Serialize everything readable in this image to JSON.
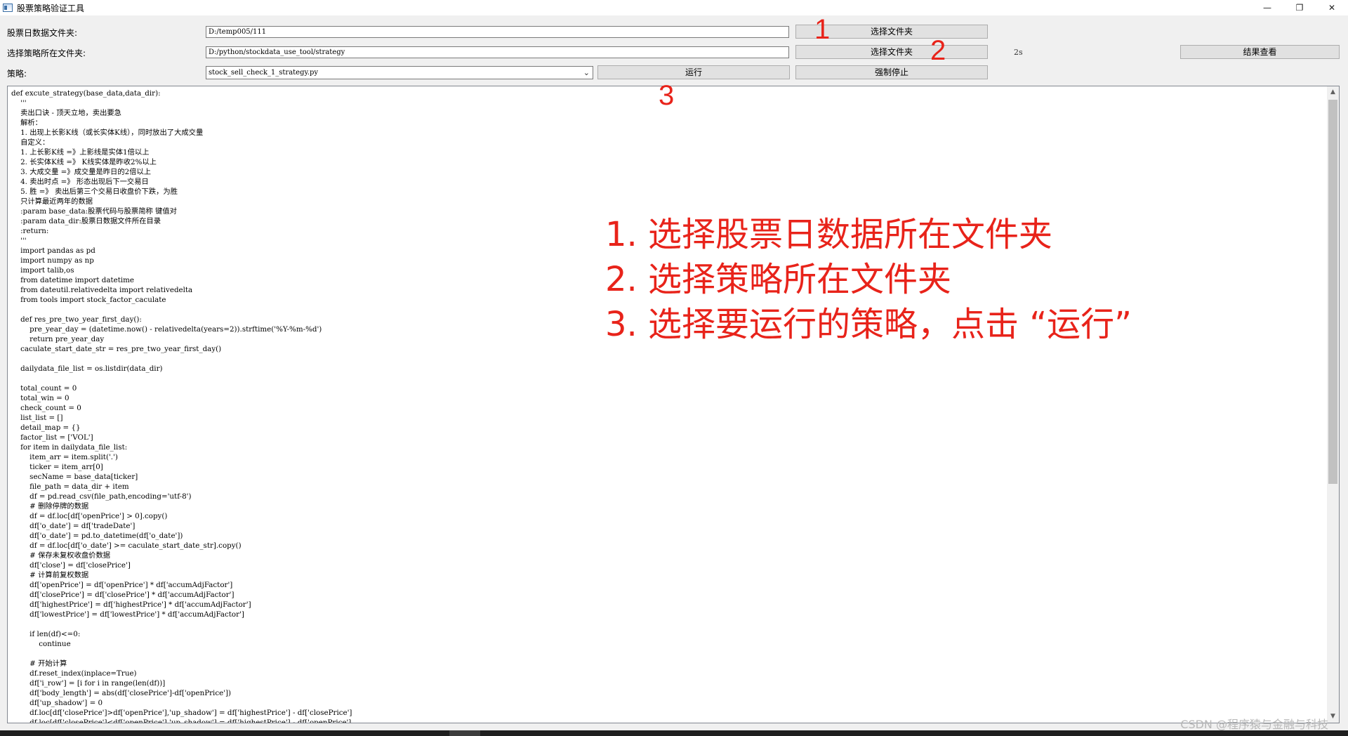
{
  "window": {
    "title": "股票策略验证工具",
    "controls": {
      "minimize": "—",
      "maximize": "❐",
      "close": "✕"
    }
  },
  "form": {
    "data_folder_label": "股票日数据文件夹:",
    "data_folder_value": "D:/temp005/111",
    "strategy_folder_label": "选择策略所在文件夹:",
    "strategy_folder_value": "D:/python/stockdata_use_tool/strategy",
    "strategy_label": "策略:",
    "strategy_selected": "stock_sell_check_1_strategy.py",
    "select_folder_button_1": "选择文件夹",
    "select_folder_button_2": "选择文件夹",
    "run_button": "运行",
    "force_stop_button": "强制停止",
    "view_results_button": "结果查看",
    "elapsed": "2s"
  },
  "code": [
    "def excute_strategy(base_data,data_dir):",
    "    '''",
    "    卖出口诀 - 顶天立地，卖出要急",
    "    解析：",
    "    1. 出现上长影K线（或长实体K线），同时放出了大成交量",
    "    自定义：",
    "    1. 上长影K线 =》上影线是实体1倍以上",
    "    2. 长实体K线 =》 K线实体是昨收2%以上",
    "    3. 大成交量 =》成交量是昨日的2倍以上",
    "    4. 卖出时点 =》 形态出现后下一交易日",
    "    5. 胜 =》 卖出后第三个交易日收盘价下跌，为胜",
    "    只计算最近两年的数据",
    "    :param base_data:股票代码与股票简称 键值对",
    "    :param data_dir:股票日数据文件所在目录",
    "    :return:",
    "    '''",
    "    import pandas as pd",
    "    import numpy as np",
    "    import talib,os",
    "    from datetime import datetime",
    "    from dateutil.relativedelta import relativedelta",
    "    from tools import stock_factor_caculate",
    "",
    "    def res_pre_two_year_first_day():",
    "        pre_year_day = (datetime.now() - relativedelta(years=2)).strftime('%Y-%m-%d')",
    "        return pre_year_day",
    "    caculate_start_date_str = res_pre_two_year_first_day()",
    "",
    "    dailydata_file_list = os.listdir(data_dir)",
    "",
    "    total_count = 0",
    "    total_win = 0",
    "    check_count = 0",
    "    list_list = []",
    "    detail_map = {}",
    "    factor_list = ['VOL']",
    "    for item in dailydata_file_list:",
    "        item_arr = item.split('.')",
    "        ticker = item_arr[0]",
    "        secName = base_data[ticker]",
    "        file_path = data_dir + item",
    "        df = pd.read_csv(file_path,encoding='utf-8')",
    "        # 删除停牌的数据",
    "        df = df.loc[df['openPrice'] > 0].copy()",
    "        df['o_date'] = df['tradeDate']",
    "        df['o_date'] = pd.to_datetime(df['o_date'])",
    "        df = df.loc[df['o_date'] >= caculate_start_date_str].copy()",
    "        # 保存未复权收盘价数据",
    "        df['close'] = df['closePrice']",
    "        # 计算前复权数据",
    "        df['openPrice'] = df['openPrice'] * df['accumAdjFactor']",
    "        df['closePrice'] = df['closePrice'] * df['accumAdjFactor']",
    "        df['highestPrice'] = df['highestPrice'] * df['accumAdjFactor']",
    "        df['lowestPrice'] = df['lowestPrice'] * df['accumAdjFactor']",
    "",
    "        if len(df)<=0:",
    "            continue",
    "",
    "        # 开始计算",
    "        df.reset_index(inplace=True)",
    "        df['i_row'] = [i for i in range(len(df))]",
    "        df['body_length'] = abs(df['closePrice']-df['openPrice'])",
    "        df['up_shadow'] = 0",
    "        df.loc[df['closePrice']>df['openPrice'],'up_shadow'] = df['highestPrice'] - df['closePrice']",
    "        df.loc[df['closePrice']<df['openPrice'],'up_shadow'] = df['highestPrice'] - df['openPrice']"
  ],
  "annotations": {
    "num_1": "1",
    "num_2": "2",
    "num_3": "3",
    "line_1": "1. 选择股票日数据所在文件夹",
    "line_2": "2. 选择策略所在文件夹",
    "line_3": "3. 选择要运行的策略，点击 “运行”",
    "color": "#e8231a"
  },
  "watermark": "CSDN @程序猿与金融与科技"
}
